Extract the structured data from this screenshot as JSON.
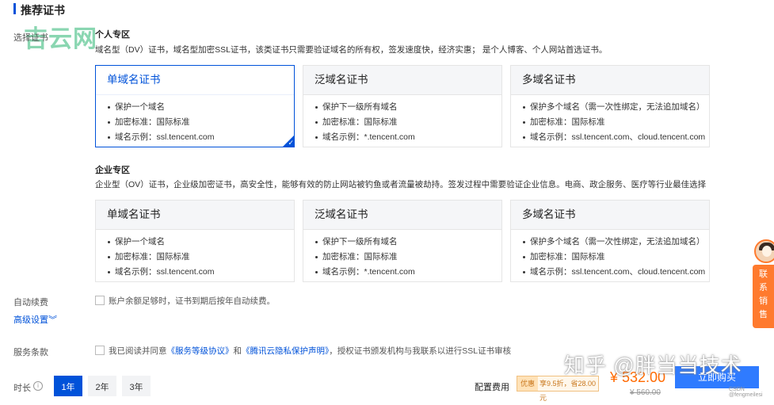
{
  "header": {
    "title": "推荐证书"
  },
  "watermark": {
    "logo_text": "吉云网",
    "zhihu": "知乎 @胖当当技术",
    "csdn": "CSDN @fengmeilesi"
  },
  "labels": {
    "select_cert": "选择证书",
    "auto_renew": "自动续费",
    "advanced": "高级设置",
    "terms": "服务条款",
    "duration": "时长"
  },
  "personal": {
    "title": "个人专区",
    "desc": "域名型（DV）证书，域名型加密SSL证书，该类证书只需要验证域名的所有权，签发速度快，经济实惠；  是个人博客、个人网站首选证书。",
    "cards": [
      {
        "title": "单域名证书",
        "items": [
          "保护一个域名",
          "加密标准：国际标准",
          "域名示例：ssl.tencent.com"
        ],
        "selected": true
      },
      {
        "title": "泛域名证书",
        "items": [
          "保护下一级所有域名",
          "加密标准：国际标准",
          "域名示例：*.tencent.com"
        ],
        "selected": false
      },
      {
        "title": "多域名证书",
        "items": [
          "保护多个域名（需一次性绑定，无法追加域名）",
          "加密标准：国际标准",
          "域名示例：ssl.tencent.com、cloud.tencent.com"
        ],
        "selected": false
      }
    ]
  },
  "enterprise": {
    "title": "企业专区",
    "desc": "企业型（OV）证书，企业级加密证书，高安全性，能够有效的防止网站被钓鱼或者流量被劫持。签发过程中需要验证企业信息。电商、政企服务、医疗等行业最佳选择",
    "cards": [
      {
        "title": "单域名证书",
        "items": [
          "保护一个域名",
          "加密标准：国际标准",
          "域名示例：ssl.tencent.com"
        ]
      },
      {
        "title": "泛域名证书",
        "items": [
          "保护下一级所有域名",
          "加密标准：国际标准",
          "域名示例：*.tencent.com"
        ]
      },
      {
        "title": "多域名证书",
        "items": [
          "保护多个域名（需一次性绑定，无法追加域名）",
          "加密标准：国际标准",
          "域名示例：ssl.tencent.com、cloud.tencent.com"
        ]
      }
    ]
  },
  "auto_renew": {
    "text": "账户余额足够时，证书到期后按年自动续费。",
    "checked": false
  },
  "terms": {
    "prefix": "我已阅读并同意",
    "link1": "《服务等级协议》",
    "and": "和",
    "link2": "《腾讯云隐私保护声明》",
    "suffix": "，授权证书颁发机构与我联系以进行SSL证书审核",
    "checked": false
  },
  "durations": [
    {
      "label": "1年",
      "active": true
    },
    {
      "label": "2年",
      "active": false
    },
    {
      "label": "3年",
      "active": false
    }
  ],
  "pricing": {
    "label": "配置费用",
    "discount_tag": "优惠",
    "discount_text": "享9.5折，省28.00元",
    "price": "¥ 532.00",
    "original": "¥ 560.00",
    "buy_label": "立即购买"
  },
  "contact": {
    "label": "联系销售"
  },
  "colors": {
    "accent": "#0052d9",
    "price": "#ff6a00",
    "contact": "#ff7a2e"
  },
  "icons": {
    "check": "check-icon",
    "chevron": "double-chevron-down-icon",
    "help": "help-icon"
  }
}
